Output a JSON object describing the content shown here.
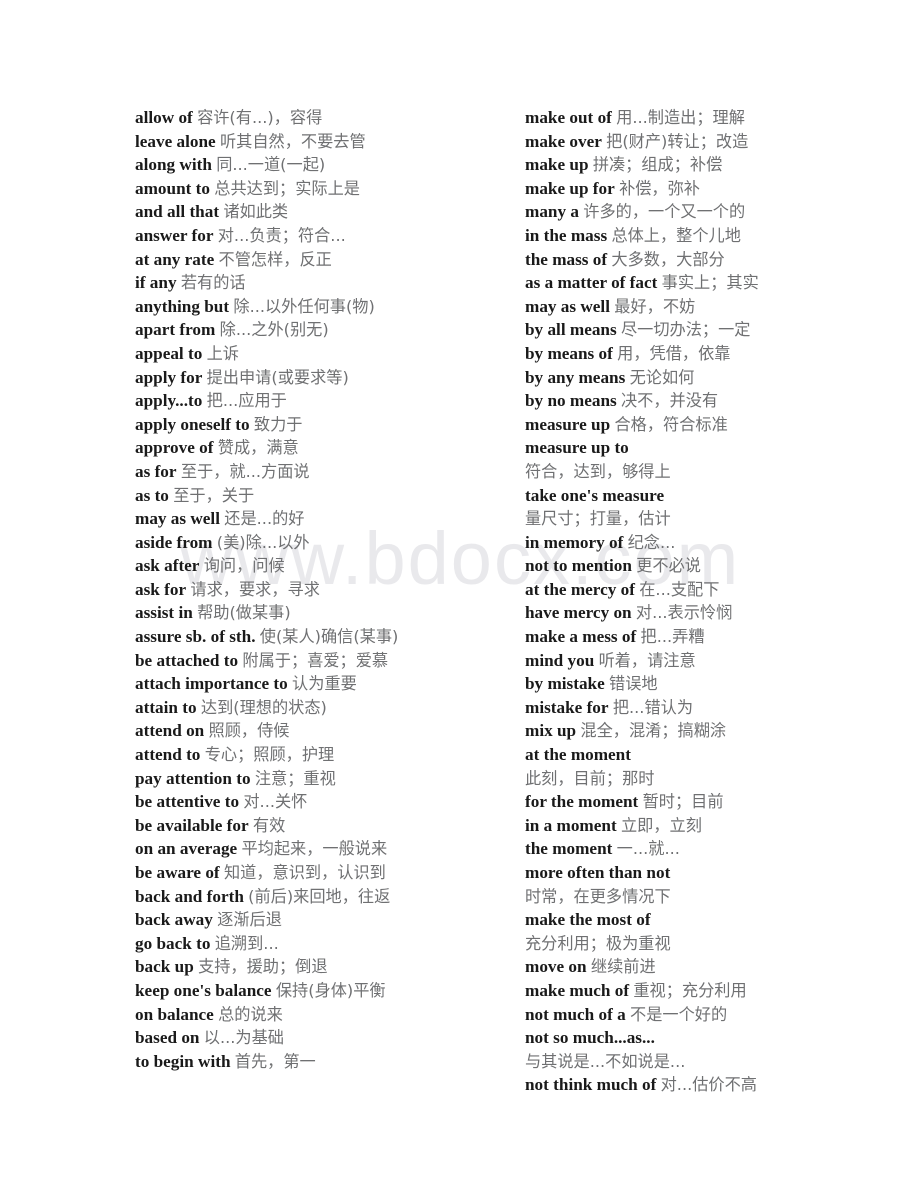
{
  "watermark": {
    "text": "www.bdocx.com"
  },
  "columns": {
    "left": [
      {
        "term": "allow of",
        "gloss": "容许(有...)，容得",
        "wrapped": false
      },
      {
        "term": "leave alone",
        "gloss": "听其自然，不要去管",
        "wrapped": false
      },
      {
        "term": "along with",
        "gloss": "同...一道(一起)",
        "wrapped": false
      },
      {
        "term": "amount to",
        "gloss": "总共达到；实际上是",
        "wrapped": false
      },
      {
        "term": "and all that",
        "gloss": "诸如此类",
        "wrapped": false
      },
      {
        "term": "answer for",
        "gloss": "对...负责；符合...",
        "wrapped": false
      },
      {
        "term": "at any rate",
        "gloss": "不管怎样，反正",
        "wrapped": false
      },
      {
        "term": "if any",
        "gloss": "若有的话",
        "wrapped": false
      },
      {
        "term": "anything but",
        "gloss": "除...以外任何事(物)",
        "wrapped": false
      },
      {
        "term": "apart from",
        "gloss": "除...之外(别无)",
        "wrapped": false
      },
      {
        "term": "appeal to",
        "gloss": "上诉",
        "wrapped": false
      },
      {
        "term": "apply for",
        "gloss": "提出申请(或要求等)",
        "wrapped": false
      },
      {
        "term": "apply...to",
        "gloss": "把...应用于",
        "wrapped": false
      },
      {
        "term": "apply oneself to",
        "gloss": "致力于",
        "wrapped": false
      },
      {
        "term": "approve of",
        "gloss": "赞成，满意",
        "wrapped": false
      },
      {
        "term": "as for",
        "gloss": "至于，就...方面说",
        "wrapped": false
      },
      {
        "term": "as to",
        "gloss": "至于，关于",
        "wrapped": false
      },
      {
        "term": "may as well",
        "gloss": "还是...的好",
        "wrapped": false
      },
      {
        "term": "aside from",
        "gloss": "(美)除...以外",
        "wrapped": false
      },
      {
        "term": "ask after",
        "gloss": "询问，问候",
        "wrapped": false
      },
      {
        "term": "ask for",
        "gloss": "请求，要求，寻求",
        "wrapped": false
      },
      {
        "term": "assist in",
        "gloss": "帮助(做某事)",
        "wrapped": false
      },
      {
        "term": "assure sb. of sth.",
        "gloss": "使(某人)确信(某事)",
        "wrapped": false
      },
      {
        "term": "be attached to",
        "gloss": "附属于；喜爱；爱慕",
        "wrapped": false
      },
      {
        "term": "attach importance to",
        "gloss": "认为重要",
        "wrapped": false
      },
      {
        "term": "attain to",
        "gloss": "达到(理想的状态)",
        "wrapped": false
      },
      {
        "term": "attend on",
        "gloss": "照顾，侍候",
        "wrapped": false
      },
      {
        "term": "attend to",
        "gloss": "专心；照顾，护理",
        "wrapped": false
      },
      {
        "term": "pay attention to",
        "gloss": "注意；重视",
        "wrapped": false
      },
      {
        "term": "be attentive to",
        "gloss": "对...关怀",
        "wrapped": false
      },
      {
        "term": "be available for",
        "gloss": "有效",
        "wrapped": false
      },
      {
        "term": "on an average",
        "gloss": "平均起来，一般说来",
        "wrapped": false
      },
      {
        "term": "be aware of",
        "gloss": "知道，意识到，认识到",
        "wrapped": false
      },
      {
        "term": "back and forth",
        "gloss": "(前后)来回地，往返",
        "wrapped": false
      },
      {
        "term": "back away",
        "gloss": "逐渐后退",
        "wrapped": false
      },
      {
        "term": "go back to",
        "gloss": "追溯到...",
        "wrapped": false
      },
      {
        "term": "back up",
        "gloss": "支持，援助；倒退",
        "wrapped": false
      },
      {
        "term": "keep one's balance",
        "gloss": "保持(身体)平衡",
        "wrapped": false
      },
      {
        "term": "on balance",
        "gloss": "总的说来",
        "wrapped": false
      },
      {
        "term": "based on",
        "gloss": "以...为基础",
        "wrapped": false
      },
      {
        "term": "to begin with",
        "gloss": "首先，第一",
        "wrapped": false
      }
    ],
    "right": [
      {
        "term": "make out of",
        "gloss": "用...制造出；理解",
        "wrapped": false
      },
      {
        "term": "make over",
        "gloss": "把(财产)转让；改造",
        "wrapped": false
      },
      {
        "term": "make up",
        "gloss": "拼凑；组成；补偿",
        "wrapped": false
      },
      {
        "term": "make up for",
        "gloss": "补偿，弥补",
        "wrapped": false
      },
      {
        "term": "many a",
        "gloss": "许多的，一个又一个的",
        "wrapped": false
      },
      {
        "term": "in the mass",
        "gloss": "总体上，整个儿地",
        "wrapped": false
      },
      {
        "term": "the mass of",
        "gloss": "大多数，大部分",
        "wrapped": false
      },
      {
        "term": "as a matter of fact",
        "gloss": "事实上；其实",
        "wrapped": false
      },
      {
        "term": "may as well",
        "gloss": "最好，不妨",
        "wrapped": false
      },
      {
        "term": "by all means",
        "gloss": "尽一切办法；一定",
        "wrapped": false
      },
      {
        "term": "by means of",
        "gloss": "用，凭借，依靠",
        "wrapped": false
      },
      {
        "term": "by any means",
        "gloss": "无论如何",
        "wrapped": false
      },
      {
        "term": "by no means",
        "gloss": "决不，并没有",
        "wrapped": false
      },
      {
        "term": "measure up",
        "gloss": "合格，符合标准",
        "wrapped": false
      },
      {
        "term": "measure up to",
        "gloss": "符合，达到，够得上",
        "wrapped": true
      },
      {
        "term": "take one's measure",
        "gloss": "量尺寸；打量，估计",
        "wrapped": true
      },
      {
        "term": "in memory of",
        "gloss": "纪念...",
        "wrapped": false
      },
      {
        "term": "not to mention",
        "gloss": "更不必说",
        "wrapped": false
      },
      {
        "term": "at the mercy of",
        "gloss": "在...支配下",
        "wrapped": false
      },
      {
        "term": "have mercy on",
        "gloss": "对...表示怜悯",
        "wrapped": false
      },
      {
        "term": "make a mess of",
        "gloss": "把...弄糟",
        "wrapped": false
      },
      {
        "term": "mind you",
        "gloss": "听着，请注意",
        "wrapped": false
      },
      {
        "term": "by mistake",
        "gloss": "错误地",
        "wrapped": false
      },
      {
        "term": "mistake for",
        "gloss": "把...错认为",
        "wrapped": false
      },
      {
        "term": "mix up",
        "gloss": "混全，混淆；搞糊涂",
        "wrapped": false
      },
      {
        "term": "at the moment",
        "gloss": "此刻，目前；那时",
        "wrapped": true
      },
      {
        "term": "for the moment",
        "gloss": "暂时；目前",
        "wrapped": false
      },
      {
        "term": "in a moment",
        "gloss": "立即，立刻",
        "wrapped": false
      },
      {
        "term": "the moment",
        "gloss": "一...就...",
        "wrapped": false
      },
      {
        "term": "more often than not",
        "gloss": "时常，在更多情况下",
        "wrapped": true
      },
      {
        "term": "make the most of",
        "gloss": "充分利用；极为重视",
        "wrapped": true
      },
      {
        "term": "move on",
        "gloss": "继续前进",
        "wrapped": false
      },
      {
        "term": "make much of",
        "gloss": "重视；充分利用",
        "wrapped": false
      },
      {
        "term": "not much of a",
        "gloss": "不是一个好的",
        "wrapped": false
      },
      {
        "term": "not so much...as...",
        "gloss": "与其说是...不如说是...",
        "wrapped": true
      },
      {
        "term": "not think much of",
        "gloss": "对...估价不高",
        "wrapped": false
      }
    ]
  }
}
